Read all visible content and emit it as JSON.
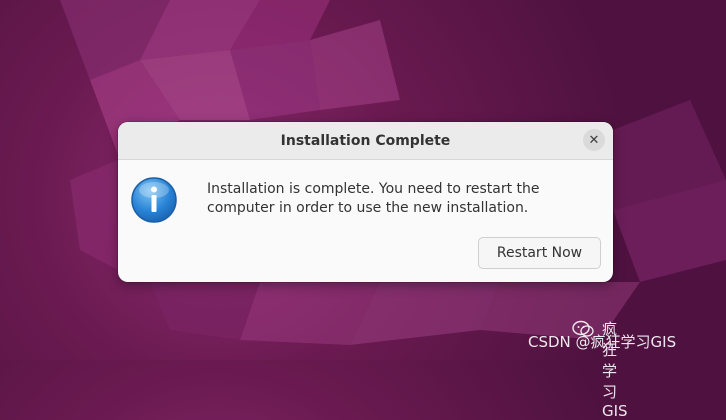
{
  "dialog": {
    "title": "Installation Complete",
    "close_glyph": "✕",
    "message": "Installation is complete. You need to restart the computer in order to use the new installation.",
    "restart_label": "Restart Now",
    "icon": "info-icon"
  },
  "watermark": {
    "line1": "疯狂学习GIS",
    "line2": "CSDN @疯狂学习GIS",
    "icon": "wechat-icon"
  },
  "colors": {
    "wallpaper": "#6a1a50",
    "accent": "#2a84d6"
  }
}
